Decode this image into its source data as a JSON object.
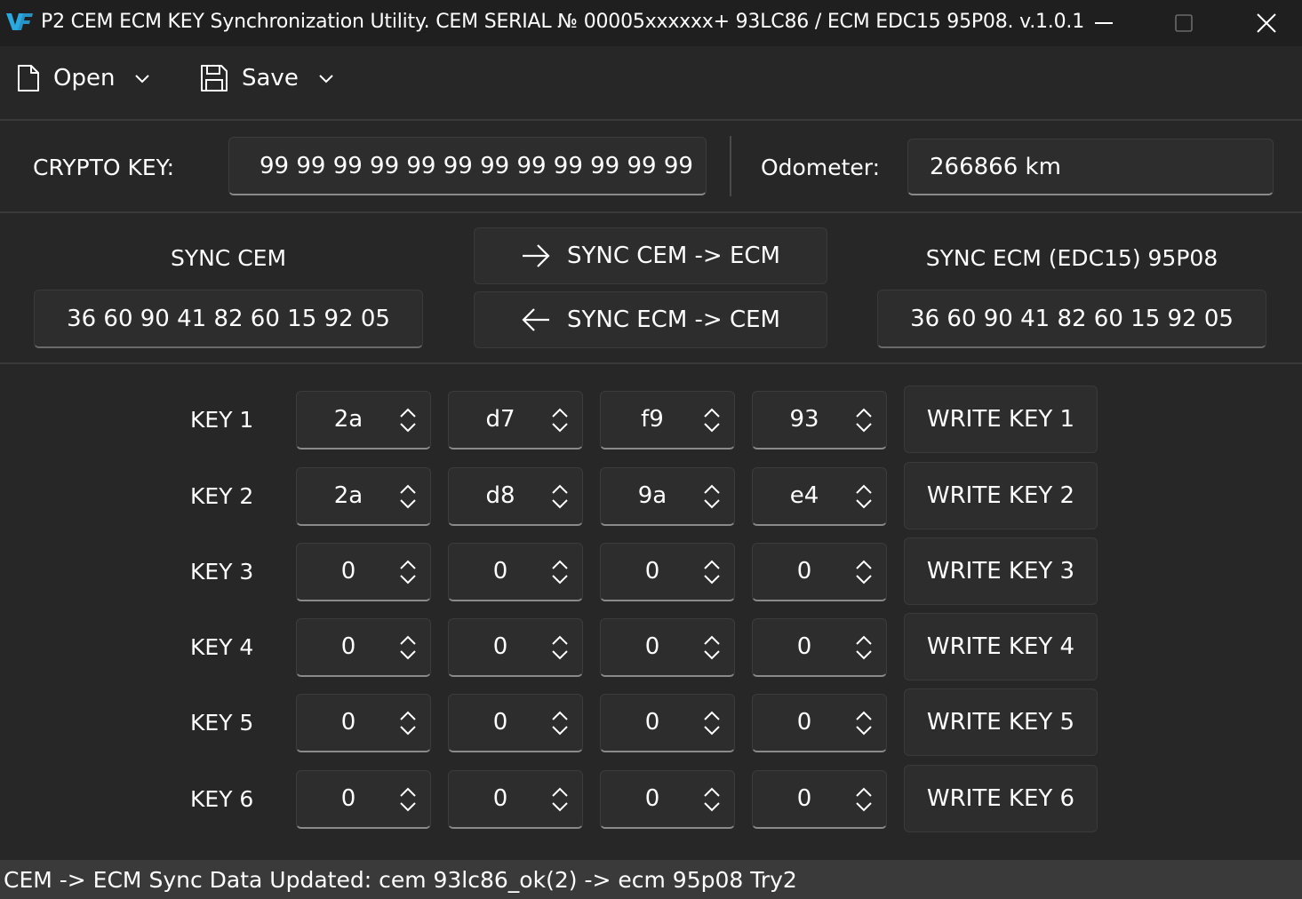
{
  "window": {
    "title": "P2 CEM ECM KEY Synchronization Utility. CEM SERIAL № 00005xxxxxx+ 93LC86 / ECM EDC15 95P08. v.1.0.1"
  },
  "toolbar": {
    "open_label": "Open",
    "save_label": "Save"
  },
  "crypto": {
    "label": "CRYPTO KEY:",
    "value": "99 99 99 99 99 99 99 99 99 99 99 99"
  },
  "odometer": {
    "label": "Odometer:",
    "value": "266866 km"
  },
  "sync": {
    "cem_label": "SYNC CEM",
    "cem_value": "36 60 90 41 82 60 15 92 05",
    "ecm_label": "SYNC ECM (EDC15) 95P08",
    "ecm_value": "36 60 90 41 82 60 15 92 05",
    "cem_to_ecm": "SYNC CEM -> ECM",
    "ecm_to_cem": "SYNC ECM -> CEM"
  },
  "keys": [
    {
      "label": "KEY 1",
      "bytes": [
        "2a",
        "d7",
        "f9",
        "93"
      ],
      "write": "WRITE KEY 1"
    },
    {
      "label": "KEY 2",
      "bytes": [
        "2a",
        "d8",
        "9a",
        "e4"
      ],
      "write": "WRITE KEY 2"
    },
    {
      "label": "KEY 3",
      "bytes": [
        "0",
        "0",
        "0",
        "0"
      ],
      "write": "WRITE KEY 3"
    },
    {
      "label": "KEY 4",
      "bytes": [
        "0",
        "0",
        "0",
        "0"
      ],
      "write": "WRITE KEY 4"
    },
    {
      "label": "KEY 5",
      "bytes": [
        "0",
        "0",
        "0",
        "0"
      ],
      "write": "WRITE KEY 5"
    },
    {
      "label": "KEY 6",
      "bytes": [
        "0",
        "0",
        "0",
        "0"
      ],
      "write": "WRITE KEY 6"
    }
  ],
  "status": {
    "text": "CEM -> ECM Sync Data Updated: cem 93lc86_ok(2) -> ecm 95p08 Try2"
  }
}
